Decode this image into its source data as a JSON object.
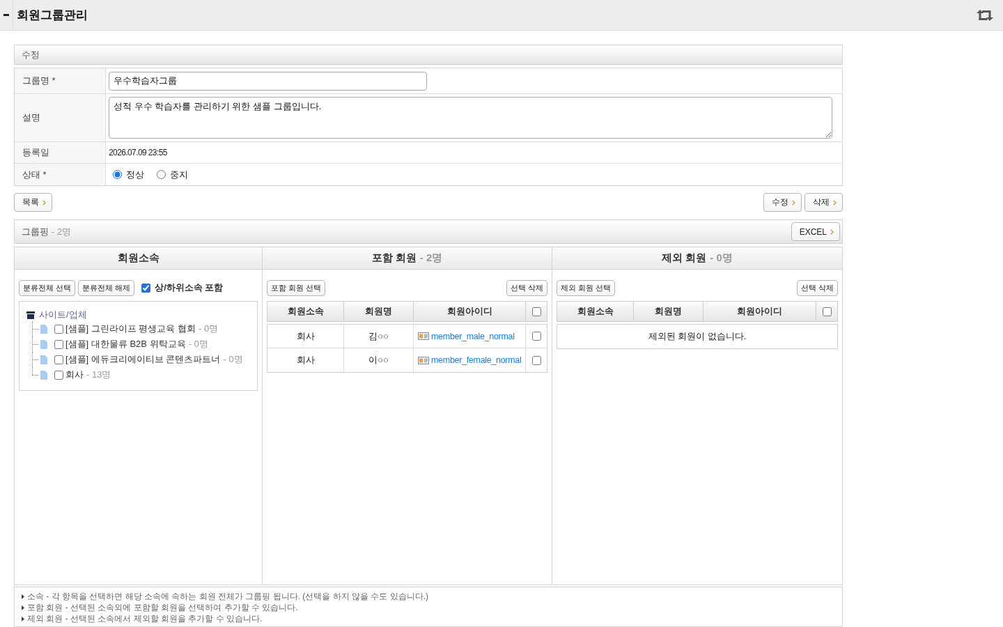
{
  "header": {
    "title": "회원그룹관리"
  },
  "edit_section": {
    "title": "수정"
  },
  "form": {
    "rows": [
      {
        "kind": "input",
        "label": "그룹명 *",
        "value": "우수학습자그룹"
      },
      {
        "kind": "textarea",
        "label": "설명",
        "value": "성적 우수 학습자를 관리하기 위한 샘플 그룹입니다."
      },
      {
        "kind": "text",
        "label": "등록일",
        "value": "2026.07.09 23:55"
      },
      {
        "kind": "radio",
        "label": "상태 *",
        "options": [
          {
            "label": "정상",
            "selected": true
          },
          {
            "label": "중지",
            "selected": false
          }
        ]
      }
    ]
  },
  "actions": {
    "left": [
      "목록"
    ],
    "right": [
      "수정",
      "삭제"
    ]
  },
  "grouping": {
    "title": "그룹핑",
    "count": "- 2명",
    "export_button": "EXCEL"
  },
  "panels": {
    "affiliation": {
      "title": "회원소속",
      "buttons": [
        "분류전체 선택",
        "분류전체 해제"
      ],
      "include_sub": {
        "label": "상/하위소속 포함",
        "checked": true
      },
      "tree": {
        "label": "사이트/업체",
        "children": [
          {
            "label": "[샘플] 그린라이프 평생교육 협회",
            "count": "- 0명",
            "checked": false
          },
          {
            "label": "[샘플] 대한물류 B2B 위탁교육",
            "count": "- 0명",
            "checked": false
          },
          {
            "label": "[샘플] 에듀크리에이티브 콘텐츠파트너",
            "count": "- 0명",
            "checked": false
          },
          {
            "label": "회사",
            "count": "- 13명",
            "checked": false
          }
        ]
      }
    },
    "included": {
      "title": "포함 회원",
      "count": "- 2명",
      "select_button": "포함 회원 선택",
      "delete_button": "선택 삭제",
      "columns": [
        "회원소속",
        "회원명",
        "회원아이디"
      ],
      "select_all_checked": false,
      "rows": [
        {
          "affiliation": "회사",
          "name": "김○○",
          "member_id": "member_male_normal",
          "checked": false
        },
        {
          "affiliation": "회사",
          "name": "이○○",
          "member_id": "member_female_normal",
          "checked": false
        }
      ]
    },
    "excluded": {
      "title": "제외 회원",
      "count": "- 0명",
      "select_button": "제외 회원 선택",
      "delete_button": "선택 삭제",
      "columns": [
        "회원소속",
        "회원명",
        "회원아이디"
      ],
      "select_all_checked": false,
      "empty_message": "제외된 회원이 없습니다."
    }
  },
  "notes": [
    "소속 - 각 항목을 선택하면 해당 소속에 속하는 회원 전체가 그룹핑 됩니다. (선택을 하지 않을 수도 있습니다.)",
    "포함 회원 - 선택된 소속외에 포함할 회원을 선택하여 추가할 수 있습니다.",
    "제외 회원 - 선택된 소속에서 제외할 회원을 추가할 수 있습니다."
  ]
}
